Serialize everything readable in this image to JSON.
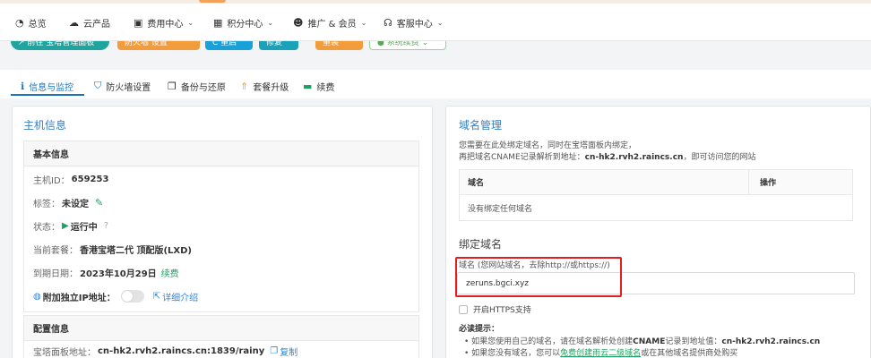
{
  "nav": {
    "items": [
      {
        "label": "总览",
        "icon": "dashboard-icon",
        "glyph": "◔",
        "dropdown": false
      },
      {
        "label": "云产品",
        "icon": "cloud-icon",
        "glyph": "☁",
        "dropdown": false
      },
      {
        "label": "费用中心",
        "icon": "video-icon",
        "glyph": "▣",
        "dropdown": true
      },
      {
        "label": "积分中心",
        "icon": "gift-icon",
        "glyph": "▦",
        "dropdown": true
      },
      {
        "label": "推广 & 会员",
        "icon": "users-icon",
        "glyph": "☻",
        "dropdown": true
      },
      {
        "label": "客服中心",
        "icon": "headset-icon",
        "glyph": "☊",
        "dropdown": true
      }
    ],
    "chevron": "⌄"
  },
  "actions": {
    "panel_button": "↗ 前往 宝塔管理面板",
    "firewall_button": "防火墙 设置",
    "restart_button": "C 重启",
    "edit_button": "修复",
    "reset_button": "重装",
    "renew_button": "● 系统续费 ⌄"
  },
  "tabs": [
    {
      "label": "信息与监控",
      "icon": "info-icon",
      "glyph": "ℹ",
      "active": true,
      "color": "#1a73b9"
    },
    {
      "label": "防火墙设置",
      "icon": "shield-icon",
      "glyph": "⛉",
      "active": false,
      "color": "#1a73b9"
    },
    {
      "label": "备份与还原",
      "icon": "copy-icon",
      "glyph": "❐",
      "active": false,
      "color": "#333333"
    },
    {
      "label": "套餐升级",
      "icon": "arrow-up-icon",
      "glyph": "⇑",
      "active": false,
      "color": "#f39c3c"
    },
    {
      "label": "续费",
      "icon": "money-icon",
      "glyph": "▬",
      "active": false,
      "color": "#20a060"
    }
  ],
  "host": {
    "title": "主机信息",
    "basic_heading": "基本信息",
    "id_label": "主机ID：",
    "id_value": "659253",
    "tag_label": "标签：",
    "tag_value": "未设定",
    "status_label": "状态：",
    "status_value": "运行中",
    "plan_label": "当前套餐：",
    "plan_value": "香港宝塔二代 顶配版(LXD)",
    "expiry_label": "到期日期：",
    "expiry_value": "2023年10月29日",
    "renew_link": "续费",
    "ip_label": "附加独立IP地址：",
    "ip_toggle_on": false,
    "ip_detail_link": "详细介绍",
    "config_heading": "配置信息",
    "panel_addr_label": "宝塔面板地址：",
    "panel_addr_value": "cn-hk2.rvh2.raincs.cn:1839/rainy",
    "copy_link": "复制"
  },
  "domain": {
    "title": "域名管理",
    "desc_line1": "您需要在此处绑定域名，同时在宝塔面板内绑定，",
    "desc_line2_prefix": "再把域名CNAME记录解析到地址：",
    "cname_target": "cn-hk2.rvh2.raincs.cn",
    "desc_line2_suffix": "，即可访问您的网站",
    "table": {
      "col_domain": "域名",
      "col_action": "操作",
      "empty_text": "没有绑定任何域名"
    },
    "bind_title": "绑定域名",
    "field_label": "域名 (您网站域名，去除http://或https://)",
    "field_value": "zeruns.bgci.xyz",
    "https_label": "开启HTTPS支持",
    "https_checked": false,
    "tips_title": "必读提示：",
    "tip1_prefix": "• 如果您使用自己的域名，请在域名解析处创建",
    "tip1_bold": "CNAME",
    "tip1_mid": "记录到地址值：",
    "tip1_target": "cn-hk2.rvh2.raincs.cn",
    "tip2_prefix": "• 如果您没有域名，您可以",
    "tip2_link": "免费创建雨云二级域名",
    "tip2_suffix": "或在其他域名提供商处购买"
  },
  "colors": {
    "accent_blue": "#1a73b9",
    "title_blue": "#3a7dbf",
    "green": "#20a060",
    "orange": "#f39c3c",
    "highlight_red": "#e02020"
  }
}
